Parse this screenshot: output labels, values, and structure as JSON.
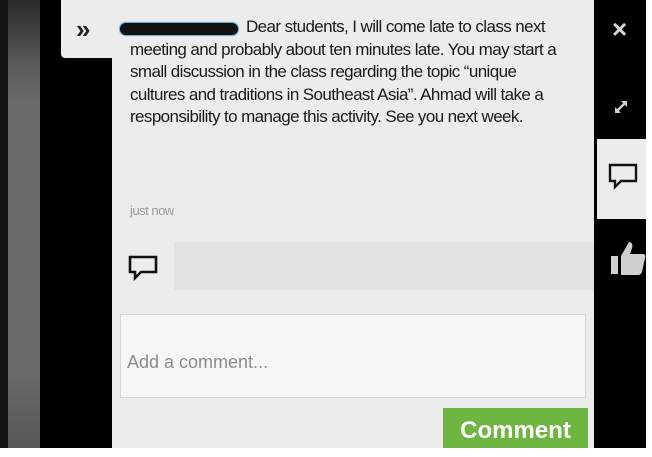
{
  "post": {
    "message": "Dear students, I will come late to class next meeting and probably about ten minutes late. You may start a small discussion in the class regarding the topic “unique cultures and traditions in Southeast Asia”. Ahmad will take a responsibility to manage this activity. See you next week.",
    "timestamp": "just now"
  },
  "comment_box": {
    "placeholder": "Add a comment...",
    "value": "",
    "submit_label": "Comment"
  },
  "icons": {
    "toggle": "»",
    "close": "×"
  },
  "colors": {
    "accent_button": "#6fb542",
    "panel_background": "#ececec"
  }
}
